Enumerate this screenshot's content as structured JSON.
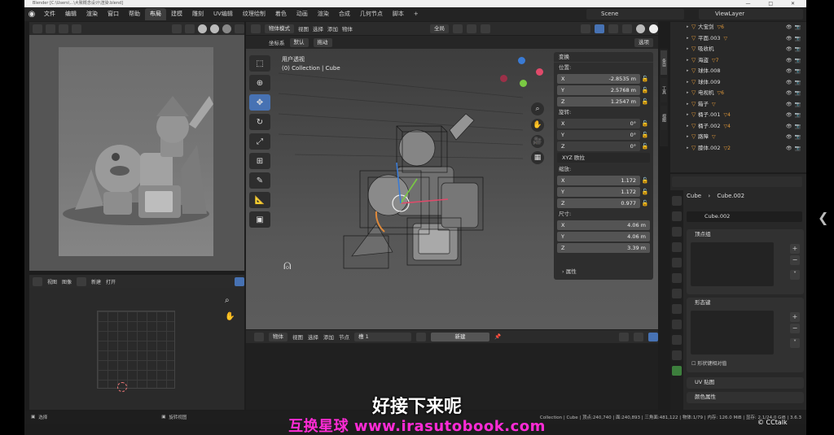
{
  "window": {
    "title": "Blender [C:\\Users\\...\\大致概念设计\\渲染.blend]",
    "buttons": [
      "—",
      "□",
      "✕"
    ]
  },
  "menu": {
    "items": [
      "文件",
      "编辑",
      "渲染",
      "窗口",
      "帮助"
    ],
    "workspaces": [
      "布局",
      "建模",
      "雕刻",
      "UV编辑",
      "纹理绘制",
      "着色",
      "动画",
      "渲染",
      "合成",
      "几何节点",
      "脚本",
      "+"
    ],
    "active_workspace": "布局",
    "scene": "Scene",
    "view_layer": "ViewLayer"
  },
  "main_view": {
    "mode": "物体模式",
    "header_menus": [
      "视图",
      "选择",
      "添加",
      "物体"
    ],
    "shading_label": "全局",
    "sub_labels": [
      "坐标系",
      "默认",
      "拖动",
      "选项"
    ],
    "info_line1": "用户透视",
    "info_line2": "(0) Collection | Cube",
    "npanel": {
      "title": "变换",
      "location_label": "位置:",
      "location": [
        {
          "axis": "X",
          "value": "-2.8535 m"
        },
        {
          "axis": "Y",
          "value": "2.5768 m"
        },
        {
          "axis": "Z",
          "value": "1.2547 m"
        }
      ],
      "rotation_label": "旋转:",
      "rotation": [
        {
          "axis": "X",
          "value": "0°"
        },
        {
          "axis": "Y",
          "value": "0°"
        },
        {
          "axis": "Z",
          "value": "0°"
        }
      ],
      "rotation_mode": "XYZ 欧拉",
      "scale_label": "缩放:",
      "scale": [
        {
          "axis": "X",
          "value": "1.172"
        },
        {
          "axis": "Y",
          "value": "1.172"
        },
        {
          "axis": "Z",
          "value": "0.977"
        }
      ],
      "dimensions_label": "尺寸:",
      "dimensions": [
        {
          "axis": "X",
          "value": "4.06 m"
        },
        {
          "axis": "Y",
          "value": "4.06 m"
        },
        {
          "axis": "Z",
          "value": "3.39 m"
        }
      ],
      "properties_label": "属性"
    },
    "side_tabs": [
      "条目",
      "工具",
      "视图"
    ]
  },
  "uv_editor": {
    "menus": [
      "视图",
      "图像"
    ],
    "new_label": "新建",
    "open_label": "打开"
  },
  "node_editor": {
    "object_label": "物体",
    "menus": [
      "视图",
      "选择",
      "添加",
      "节点"
    ],
    "slot": "槽 1",
    "new_label": "新建"
  },
  "outliner": {
    "rows": [
      {
        "name": "大宝剑",
        "mod": "▽6"
      },
      {
        "name": "平面.003",
        "mod": "▽"
      },
      {
        "name": "吸收机",
        "mod": ""
      },
      {
        "name": "海盗",
        "mod": "▽7"
      },
      {
        "name": "球体.008",
        "mod": ""
      },
      {
        "name": "球体.009",
        "mod": ""
      },
      {
        "name": "电视机",
        "mod": "▽6"
      },
      {
        "name": "箱子",
        "mod": "▽"
      },
      {
        "name": "桶子.001",
        "mod": "▽4"
      },
      {
        "name": "桶子.002",
        "mod": "▽4"
      },
      {
        "name": "路障",
        "mod": "▽"
      },
      {
        "name": "膝体.002",
        "mod": "▽2"
      }
    ]
  },
  "properties": {
    "breadcrumb_obj": "Cube",
    "breadcrumb_data": "Cube.002",
    "mesh_name": "Cube.002",
    "vertex_groups": "顶点组",
    "shape_keys": "形态键",
    "relative_label": "形状键相对值",
    "uv_maps": "UV 贴图",
    "color_attrs": "颜色属性"
  },
  "status": {
    "left_select": "选择",
    "left_rotate": "旋转视图",
    "right": "Collection | Cube | 顶点:240,740 | 面:240,893 | 三角面:481,122 | 物体:1/79 | 内存: 126.0 MiB | 显存: 2.1/24.0 GiB | 3.6.3"
  },
  "overlay": {
    "subtitle": "好接下来呢",
    "watermark": "互换星球 www.irasutobook.com",
    "cctalk": "CCtalk"
  }
}
